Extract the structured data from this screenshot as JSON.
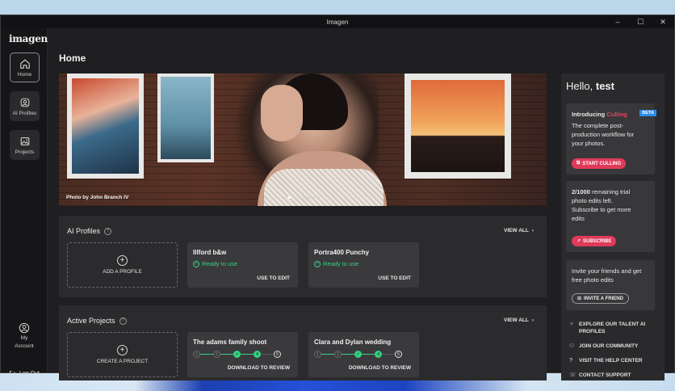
{
  "window": {
    "title": "Imagen",
    "controls": {
      "minimize": "–",
      "maximize": "☐",
      "close": "✕"
    }
  },
  "sidebar": {
    "logo": "imagen",
    "items": [
      {
        "label": "Home",
        "icon": "home-icon",
        "active": true
      },
      {
        "label": "AI Profiles",
        "icon": "ai-profiles-icon",
        "active": false
      },
      {
        "label": "Projects",
        "icon": "projects-icon",
        "active": false
      }
    ],
    "account": {
      "line1": "My",
      "line2": "Account"
    },
    "logout": "Log Out"
  },
  "main": {
    "page_title": "Home",
    "hero": {
      "credit": "Photo by John Branch IV",
      "slide_count": 8,
      "active_slide": 1
    },
    "ai_profiles": {
      "title": "AI Profiles",
      "view_all": "VIEW ALL",
      "add_label": "ADD A PROFILE",
      "cards": [
        {
          "name": "Illford b&w",
          "status": "Ready to use",
          "action": "USE TO EDIT"
        },
        {
          "name": "Portra400 Punchy",
          "status": "Ready to use",
          "action": "USE TO EDIT"
        }
      ]
    },
    "projects": {
      "title": "Active Projects",
      "view_all": "VIEW ALL",
      "add_label": "CREATE A PROJECT",
      "cards": [
        {
          "name": "The adams family shoot",
          "action": "DOWNLOAD TO REVIEW",
          "steps": [
            "1",
            "2",
            "✓",
            "4",
            "5"
          ]
        },
        {
          "name": "Clara and Dylan wedding",
          "action": "DOWNLOAD TO REVIEW",
          "steps": [
            "1",
            "2",
            "✓",
            "4",
            "5"
          ]
        }
      ]
    }
  },
  "right_panel": {
    "greeting": "Hello,",
    "username": "test",
    "culling": {
      "intro": "Introducing",
      "feature": "Culling",
      "badge": "BETA",
      "desc_1": "The complete post-",
      "desc_2": "production workflow for",
      "desc_3": "your photos.",
      "button": "START CULLING"
    },
    "trial": {
      "count": "2/1000",
      "line_1": " remaining trial",
      "line_2": "photo edits left.",
      "line_3": "Subscribe to get more",
      "line_4": "edits",
      "button": "SUBSCRIBE"
    },
    "invite": {
      "line_1": "Invite your friends and get",
      "line_2": "free photo edits",
      "button": "INVITE A FRIEND"
    },
    "links": [
      {
        "line1": "EXPLORE OUR TALENT AI",
        "line2": "PROFILES"
      },
      {
        "line1": "JOIN OUR COMMUNITY",
        "line2": ""
      },
      {
        "line1": "VISIT THE HELP CENTER",
        "line2": ""
      },
      {
        "line1": "CONTACT SUPPORT",
        "line2": ""
      }
    ]
  },
  "colors": {
    "accent_pink": "#e03a5b",
    "success_green": "#35d07f",
    "beta_blue": "#2d8ce6"
  }
}
